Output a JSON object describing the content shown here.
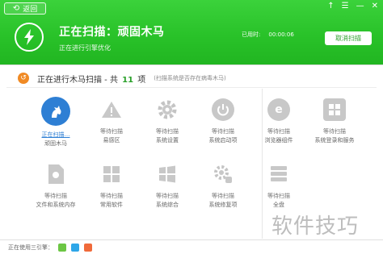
{
  "window": {
    "back_label": "返回",
    "controls": [
      "↑",
      "☰",
      "—",
      "✕"
    ]
  },
  "header": {
    "title": "正在扫描：顽固木马",
    "subtitle": "正在进行引擎优化",
    "elapsed_label": "已用时:",
    "elapsed_value": "00:00:06",
    "cancel_label": "取消扫描"
  },
  "scan": {
    "title_prefix": "正在进行木马扫描 - 共",
    "count": "11",
    "title_suffix": "项",
    "note": "(扫描系统是否存在病毒木马)"
  },
  "items": [
    {
      "status": "正在扫描…",
      "label": "顽固木马",
      "icon": "horse-icon",
      "active": true
    },
    {
      "status": "等待扫描",
      "label": "易感区",
      "icon": "warning-icon"
    },
    {
      "status": "等待扫描",
      "label": "系统设置",
      "icon": "gear-icon"
    },
    {
      "status": "等待扫描",
      "label": "系统启动项",
      "icon": "power-icon"
    },
    {
      "status": "等待扫描",
      "label": "浏览器组件",
      "icon": "browser-icon"
    },
    {
      "status": "等待扫描",
      "label": "系统登录和服务",
      "icon": "puzzle-icon"
    },
    {
      "status": "等待扫描",
      "label": "文件和系统内存",
      "icon": "file-icon"
    },
    {
      "status": "等待扫描",
      "label": "常用软件",
      "icon": "apps-icon"
    },
    {
      "status": "等待扫描",
      "label": "系统综合",
      "icon": "windows-icon"
    },
    {
      "status": "等待扫描",
      "label": "系统修复项",
      "icon": "repair-icon"
    },
    {
      "status": "等待扫描",
      "label": "全盘",
      "icon": "disk-icon"
    }
  ],
  "footer": {
    "label": "正在使用三引擎："
  },
  "watermark": "软件技巧"
}
